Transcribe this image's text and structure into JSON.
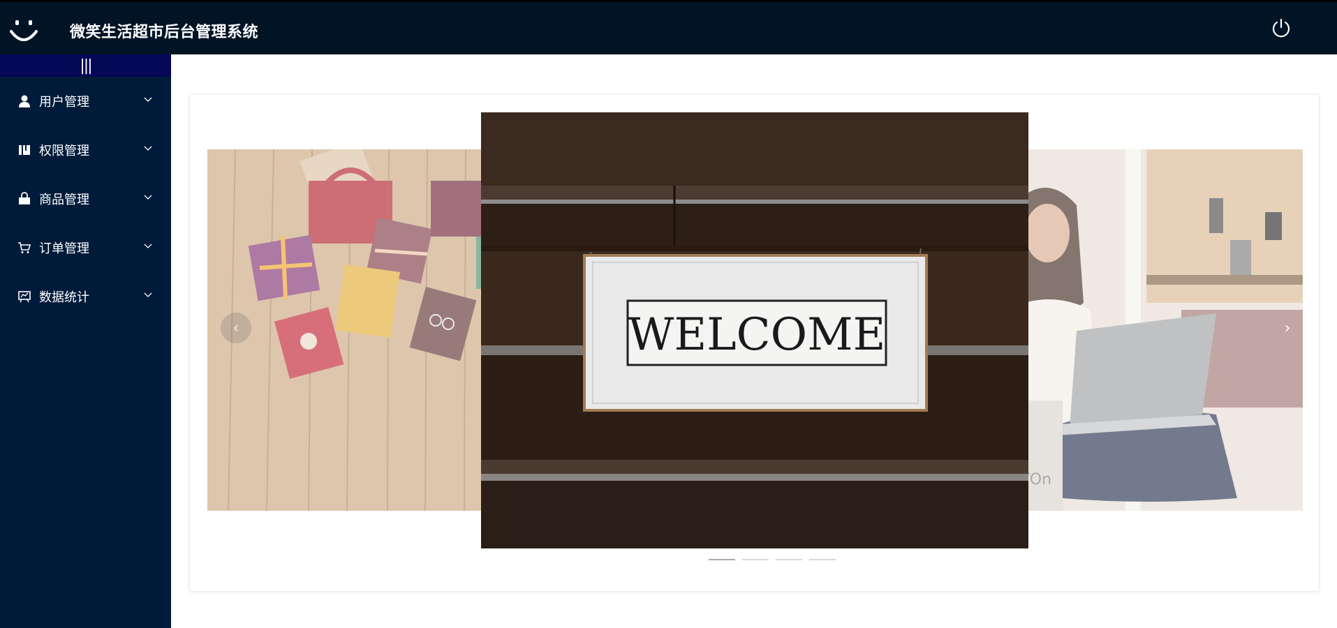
{
  "header": {
    "title": "微笑生活超市后台管理系统",
    "logo_icon": "smiley-face-icon",
    "logout_icon": "power-icon",
    "bg_color": "#011426"
  },
  "sidebar": {
    "toggle_label": "|||",
    "bg_color": "#001b3a",
    "items": [
      {
        "label": "用户管理",
        "icon": "user-icon"
      },
      {
        "label": "权限管理",
        "icon": "book-icon"
      },
      {
        "label": "商品管理",
        "icon": "shopping-bag-icon"
      },
      {
        "label": "订单管理",
        "icon": "cart-icon"
      },
      {
        "label": "数据统计",
        "icon": "chart-board-icon"
      }
    ]
  },
  "carousel": {
    "slides": [
      {
        "name": "gift-boxes-photo"
      },
      {
        "name": "welcome-sign-photo",
        "sign_text": "WELCOME"
      },
      {
        "name": "woman-laptop-photo",
        "bag_text": "ATOn"
      }
    ],
    "prev_label": "‹",
    "next_label": "›",
    "indicator_count": 4,
    "active_index": 0
  }
}
